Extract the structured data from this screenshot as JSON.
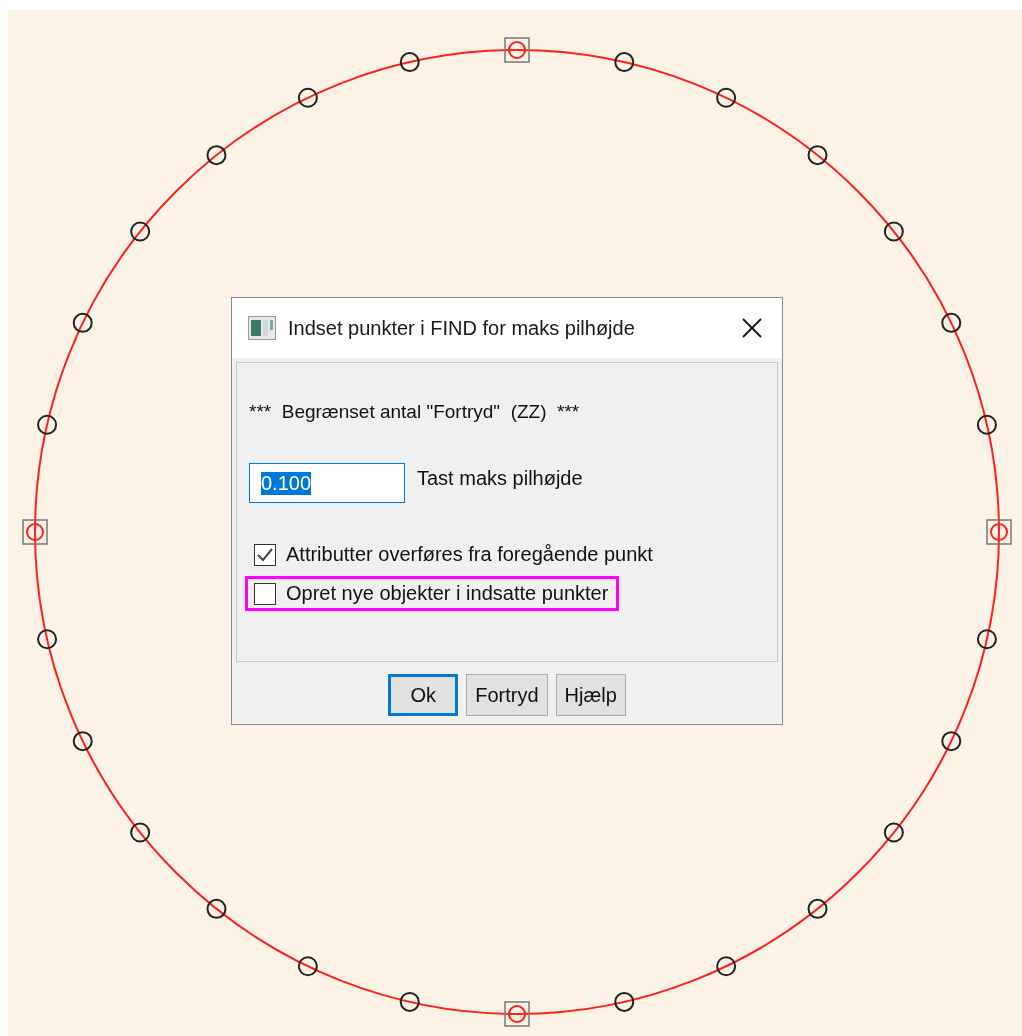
{
  "dialog": {
    "title": "Indset punkter i FIND for maks pilhøjde",
    "message": "***  Begrænset antal \"Fortryd\"  (ZZ)  ***",
    "field": {
      "value": "0.100",
      "value_selected": true,
      "label": "Tast maks pilhøjde"
    },
    "checkboxes": [
      {
        "label": "Attributter overføres fra foregående punkt",
        "checked": true,
        "highlighted": false
      },
      {
        "label": "Opret nye objekter i indsatte punkter",
        "checked": false,
        "highlighted": true
      }
    ],
    "buttons": [
      {
        "label": "Ok",
        "focused": true
      },
      {
        "label": "Fortryd",
        "focused": false
      },
      {
        "label": "Hjælp",
        "focused": false
      }
    ]
  }
}
